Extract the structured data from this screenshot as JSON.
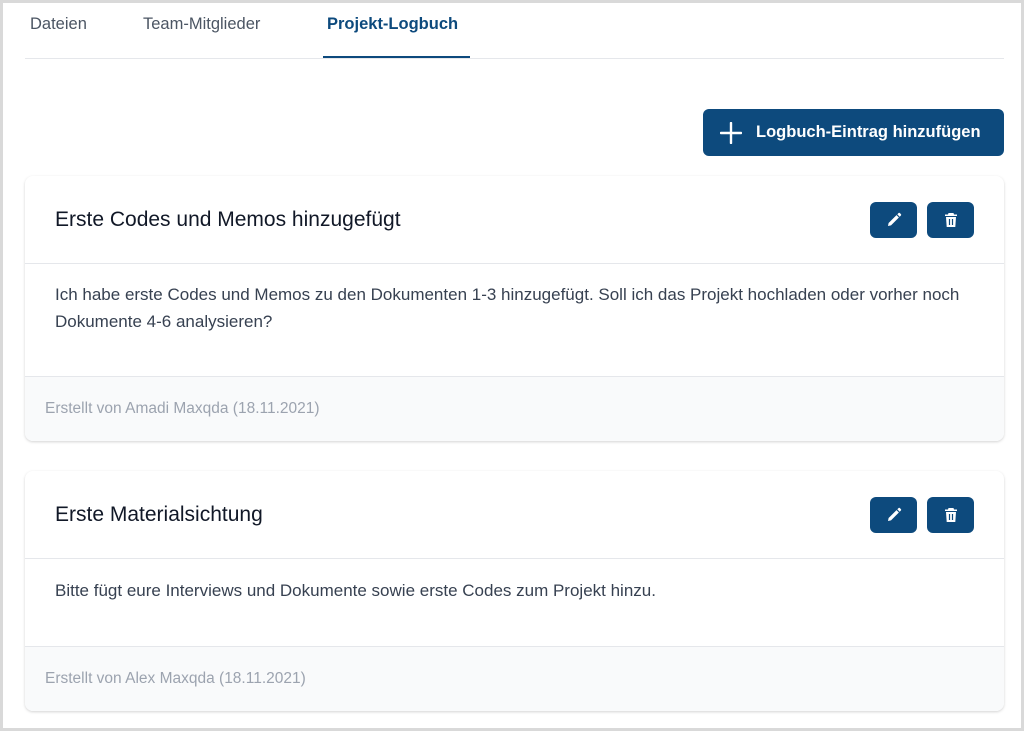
{
  "tabs": [
    {
      "label": "Dateien",
      "active": false
    },
    {
      "label": "Team-Mitglieder",
      "active": false
    },
    {
      "label": "Projekt-Logbuch",
      "active": true
    }
  ],
  "toolbar": {
    "add_label": "Logbuch-Eintrag hinzufügen"
  },
  "entries": [
    {
      "title": "Erste Codes und Memos hinzugefügt",
      "text": "Ich habe erste Codes und Memos zu den Dokumenten 1-3 hinzugefügt. Soll ich das Projekt hochladen oder vorher noch Dokumente 4-6 analysieren?",
      "footer": "Erstellt von Amadi Maxqda (18.11.2021)"
    },
    {
      "title": "Erste Materialsichtung",
      "text": "Bitte fügt eure Interviews und Dokumente sowie erste Codes zum Projekt hinzu.",
      "footer": "Erstellt von Alex Maxqda (18.11.2021)"
    }
  ],
  "colors": {
    "accent": "#0d4a7d",
    "footer_bg": "#f9fafb",
    "muted_text": "#9ca3af"
  },
  "icons": {
    "add": "plus-icon",
    "edit": "pencil-icon",
    "delete": "trash-icon"
  }
}
